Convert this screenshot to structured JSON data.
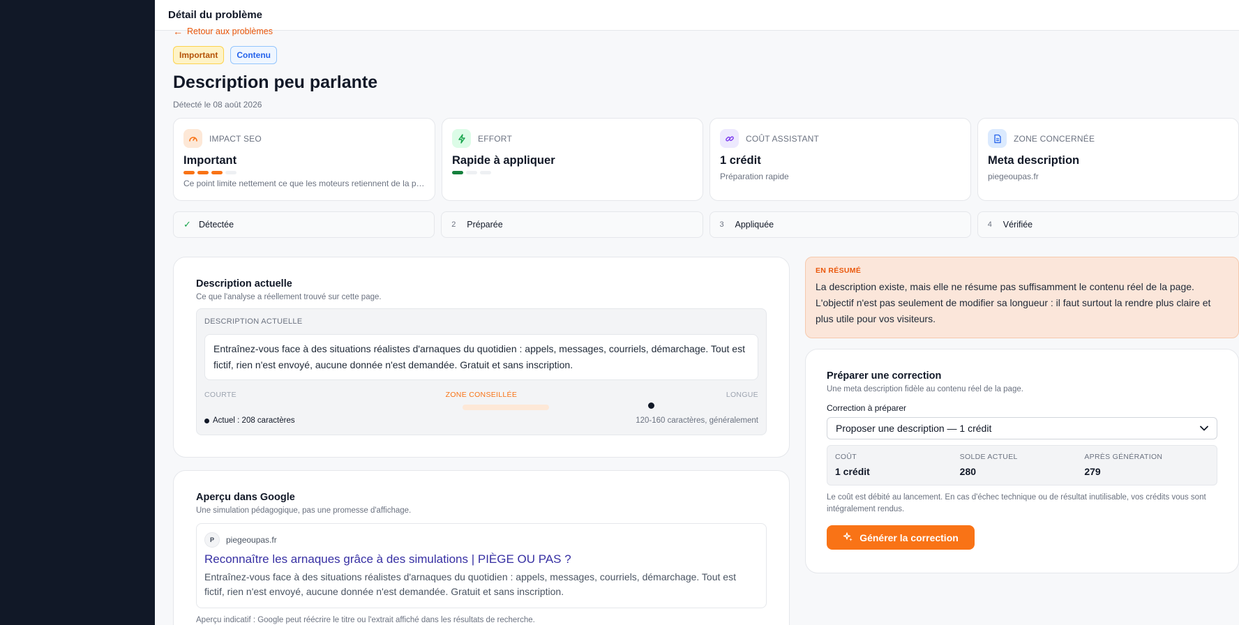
{
  "header": {
    "title": "Détail du problème"
  },
  "back_link": {
    "label": "Retour aux problèmes"
  },
  "badges": [
    {
      "label": "Important"
    },
    {
      "label": "Contenu"
    }
  ],
  "page": {
    "title": "Description peu parlante",
    "detected": "Détecté le 08 août 2026"
  },
  "metrics": [
    {
      "label": "IMPACT SEO",
      "value": "Important",
      "sub": "Ce point limite nettement ce que les moteurs retiennent de la page.",
      "icon": "gauge-icon",
      "level": 3,
      "max": 4,
      "color": "#f97316"
    },
    {
      "label": "EFFORT",
      "value": "Rapide à appliquer",
      "sub": "",
      "icon": "bolt-icon",
      "level": 1,
      "max": 3,
      "color": "#15803d"
    },
    {
      "label": "COÛT ASSISTANT",
      "value": "1 crédit",
      "sub": "Préparation rapide",
      "icon": "link-icon"
    },
    {
      "label": "ZONE CONCERNÉE",
      "value": "Meta description",
      "sub": "piegeoupas.fr",
      "icon": "document-icon"
    }
  ],
  "steps": [
    {
      "marker": "✓",
      "label": "Détectée"
    },
    {
      "marker": "2",
      "label": "Préparée"
    },
    {
      "marker": "3",
      "label": "Appliquée"
    },
    {
      "marker": "4",
      "label": "Vérifiée"
    }
  ],
  "current_description": {
    "title": "Description actuelle",
    "subtitle": "Ce que l'analyse a réellement trouvé sur cette page.",
    "box_label": "DESCRIPTION ACTUELLE",
    "text": "Entraînez-vous face à des situations réalistes d'arnaques du quotidien : appels, messages, courriels, démarchage. Tout est fictif, rien n'est envoyé, aucune donnée n'est demandée. Gratuit et sans inscription.",
    "scale": {
      "short_label": "COURTE",
      "zone_label": "ZONE CONSEILLÉE",
      "long_label": "LONGUE",
      "current_label": "Actuel : 208 caractères",
      "current_chars": 208,
      "range_label": "120-160 caractères, généralement"
    }
  },
  "google_preview": {
    "title": "Aperçu dans Google",
    "subtitle": "Une simulation pédagogique, pas une promesse d'affichage.",
    "favicon_letter": "P",
    "site": "piegeoupas.fr",
    "result_title": "Reconnaître les arnaques grâce à des simulations | PIÈGE OU PAS ?",
    "result_desc": "Entraînez-vous face à des situations réalistes d'arnaques du quotidien : appels, messages, courriels, démarchage. Tout est fictif, rien n'est envoyé, aucune donnée n'est demandée. Gratuit et sans inscription.",
    "note": "Aperçu indicatif : Google peut réécrire le titre ou l'extrait affiché dans les résultats de recherche."
  },
  "summary": {
    "label": "EN RÉSUMÉ",
    "text": "La description existe, mais elle ne résume pas suffisamment le contenu réel de la page. L'objectif n'est pas seulement de modifier sa longueur : il faut surtout la rendre plus claire et plus utile pour vos visiteurs."
  },
  "prepare": {
    "title": "Préparer une correction",
    "subtitle": "Une meta description fidèle au contenu réel de la page.",
    "field_label": "Correction à préparer",
    "select_value": "Proposer une description — 1 crédit",
    "credits": [
      {
        "label": "COÛT",
        "value": "1 crédit"
      },
      {
        "label": "SOLDE ACTUEL",
        "value": "280"
      },
      {
        "label": "APRÈS GÉNÉRATION",
        "value": "279"
      }
    ],
    "note": "Le coût est débité au lancement. En cas d'échec technique ou de résultat inutilisable, vos crédits vous sont intégralement rendus.",
    "button_label": "Générer la correction"
  },
  "colors": {
    "accent": "#f97316",
    "sidebar": "#111827"
  }
}
